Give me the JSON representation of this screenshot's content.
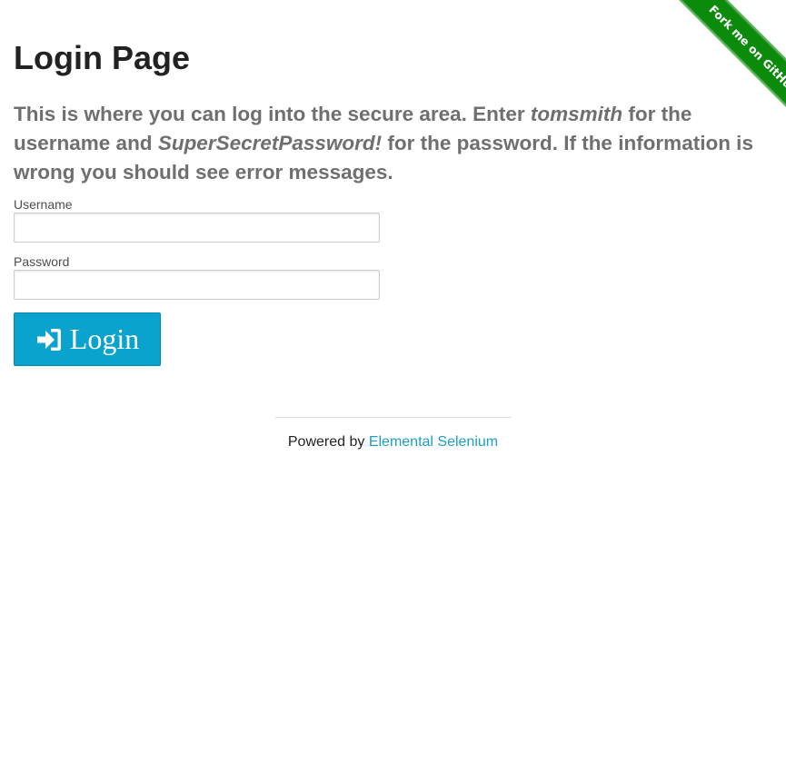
{
  "page": {
    "title": "Login Page",
    "intro": {
      "part1": "This is where you can log into the secure area. Enter ",
      "username_hint": "tomsmith",
      "part2": " for the username and ",
      "password_hint": "SuperSecretPassword!",
      "part3": " for the password. If the information is wrong you should see error messages."
    }
  },
  "form": {
    "username_label": "Username",
    "username_value": "",
    "password_label": "Password",
    "password_value": "",
    "login_label": "Login",
    "login_icon": "sign-in-icon"
  },
  "footer": {
    "prefix": "Powered by ",
    "link_text": "Elemental Selenium"
  },
  "ribbon": {
    "text": "Fork me on GitHub",
    "color": "#0c8a0c"
  },
  "colors": {
    "accent": "#0aa3ce",
    "link": "#1a9fc6"
  }
}
